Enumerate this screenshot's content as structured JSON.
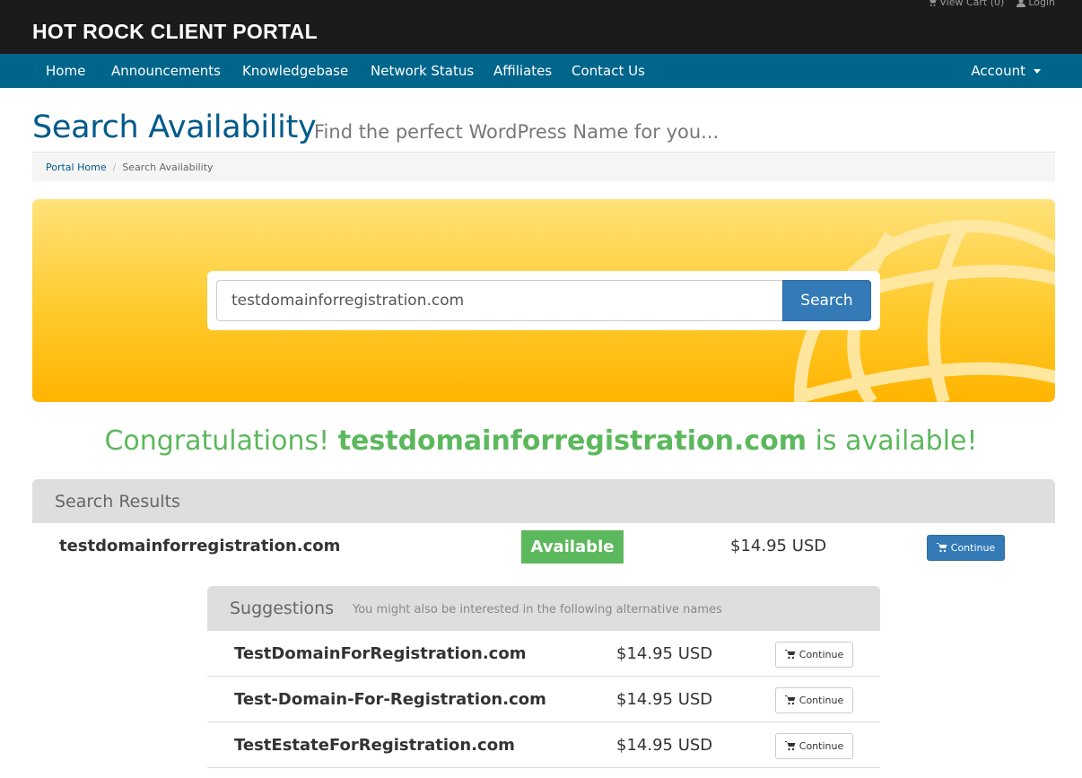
{
  "header": {
    "brand": "HOT ROCK CLIENT PORTAL",
    "view_cart": "View Cart (0)",
    "login": "Login"
  },
  "nav": {
    "items": [
      "Home",
      "Announcements",
      "Knowledgebase",
      "Network Status",
      "Affiliates",
      "Contact Us"
    ],
    "account": "Account"
  },
  "page": {
    "title": "Search Availability",
    "subtitle": "Find the perfect WordPress Name for you..."
  },
  "breadcrumb": {
    "home": "Portal Home",
    "separator": "/",
    "current": "Search Availability"
  },
  "search": {
    "value": "testdomainforregistration.com",
    "button": "Search"
  },
  "message": {
    "prefix": "Congratulations! ",
    "domain": "testdomainforregistration.com",
    "suffix": " is available!"
  },
  "results": {
    "title": "Search Results",
    "domain": "testdomainforregistration.com",
    "status": "Available",
    "price": "$14.95 USD",
    "button": "Continue"
  },
  "suggestions": {
    "title": "Suggestions",
    "subtitle": "You might also be interested in the following alternative names",
    "items": [
      {
        "name": "TestDomainForRegistration.com",
        "price": "$14.95 USD",
        "button": "Continue"
      },
      {
        "name": "Test-Domain-For-Registration.com",
        "price": "$14.95 USD",
        "button": "Continue"
      },
      {
        "name": "TestEstateForRegistration.com",
        "price": "$14.95 USD",
        "button": "Continue"
      }
    ]
  },
  "colors": {
    "topbar": "#1c1b1b",
    "navbar": "#00658b",
    "title": "#005a8a",
    "success": "#5cb85c",
    "primary": "#337ab7",
    "hero_top": "#ffe27a",
    "hero_bottom": "#ffb400"
  },
  "icons": {
    "cart": "shopping-cart-icon",
    "user": "user-icon",
    "globe": "globe-icon"
  }
}
